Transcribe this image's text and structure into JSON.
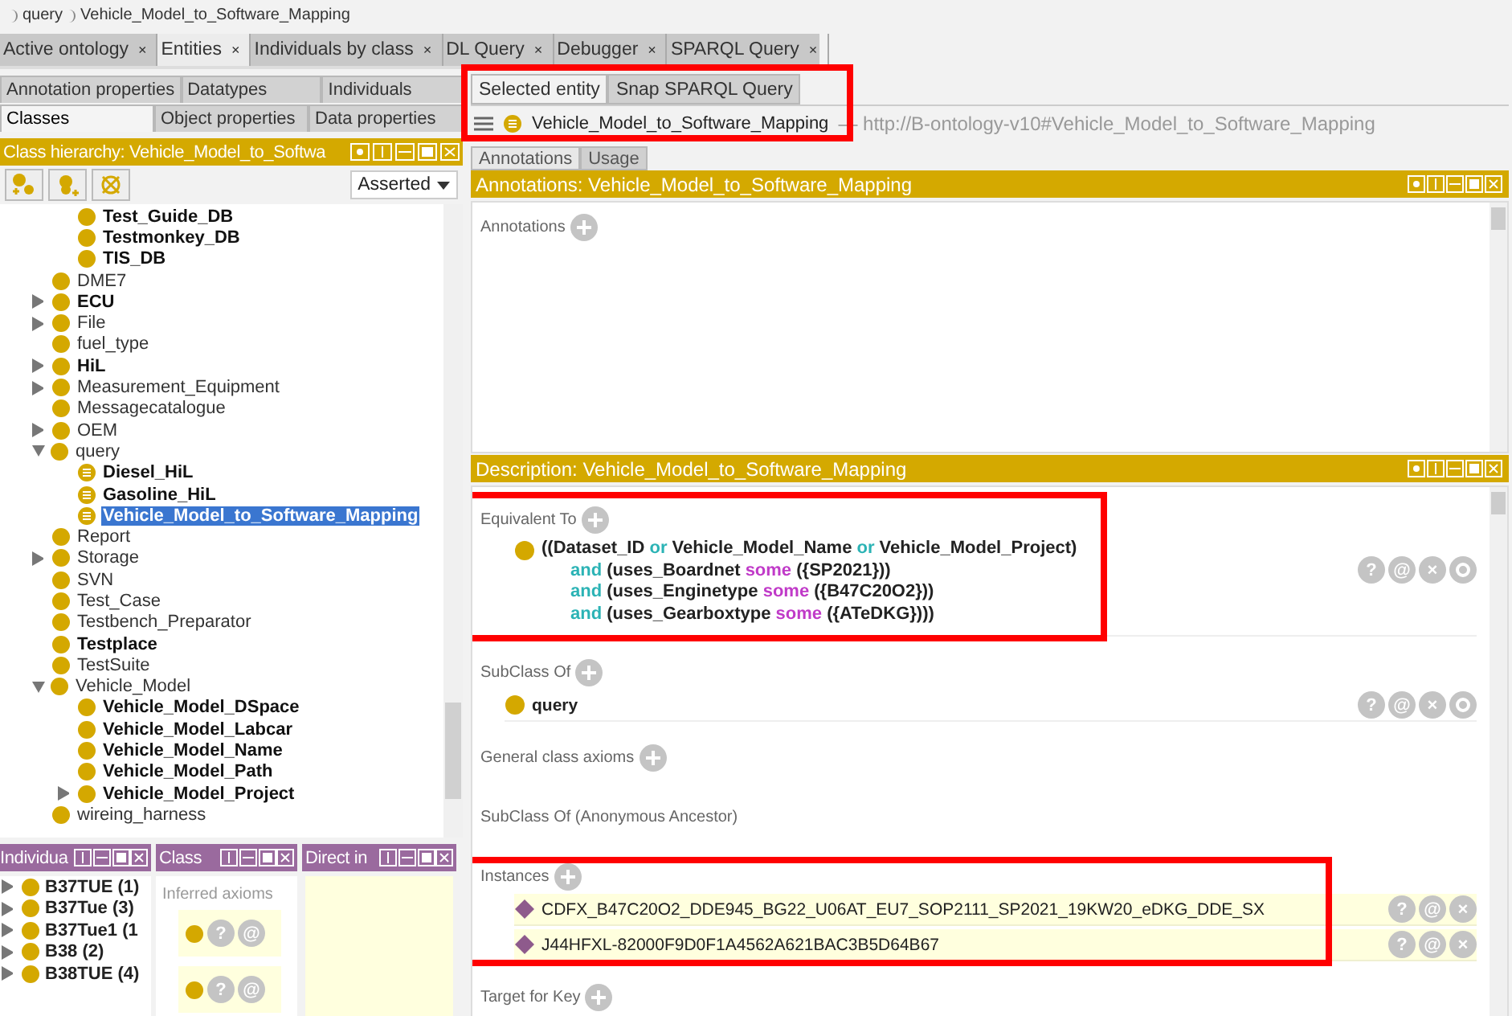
{
  "breadcrumb": [
    "query",
    "Vehicle_Model_to_Software_Mapping"
  ],
  "main_tabs": [
    {
      "label": "Active ontology",
      "close": "×",
      "selected": false
    },
    {
      "label": "Entities",
      "close": "×",
      "selected": true
    },
    {
      "label": "Individuals by class",
      "close": "×",
      "selected": false
    },
    {
      "label": "DL Query",
      "close": "×",
      "selected": false
    },
    {
      "label": "Debugger",
      "close": "×",
      "selected": false
    },
    {
      "label": "SPARQL Query",
      "close": "×",
      "selected": false
    }
  ],
  "left": {
    "tab_rows": [
      [
        {
          "label": "Annotation properties",
          "selected": false
        },
        {
          "label": "Datatypes",
          "selected": false
        },
        {
          "label": "Individuals",
          "selected": false
        }
      ],
      [
        {
          "label": "Classes",
          "selected": true
        },
        {
          "label": "Object properties",
          "selected": false
        },
        {
          "label": "Data properties",
          "selected": false
        }
      ]
    ],
    "hierarchy": {
      "title": "Class hierarchy: Vehicle_Model_to_Softwa",
      "mode": "Asserted",
      "partial_children": [
        {
          "label": "Test_Guide_DB",
          "bold": true,
          "defined": false,
          "selected": false
        },
        {
          "label": "Testmonkey_DB",
          "bold": true,
          "defined": false,
          "selected": false
        },
        {
          "label": "TIS_DB",
          "bold": true,
          "defined": false,
          "selected": false
        }
      ],
      "items": [
        {
          "label": "DME7",
          "bold": false,
          "defined": false,
          "selected": false
        },
        {
          "label": "ECU",
          "bold": true,
          "expanded": false,
          "defined": false,
          "selected": false
        },
        {
          "label": "File",
          "bold": false,
          "expanded": false,
          "defined": false,
          "selected": false
        },
        {
          "label": "fuel_type",
          "bold": false,
          "defined": false,
          "selected": false
        },
        {
          "label": "HiL",
          "bold": true,
          "expanded": false,
          "defined": false,
          "selected": false
        },
        {
          "label": "Measurement_Equipment",
          "bold": false,
          "expanded": false,
          "defined": false,
          "selected": false
        },
        {
          "label": "Messagecatalogue",
          "bold": false,
          "defined": false,
          "selected": false
        },
        {
          "label": "OEM",
          "bold": false,
          "expanded": false,
          "defined": false,
          "selected": false
        },
        {
          "label": "query",
          "bold": false,
          "expanded": true,
          "defined": false,
          "selected": false,
          "children": [
            {
              "label": "Diesel_HiL",
              "bold": true,
              "defined": true,
              "selected": false
            },
            {
              "label": "Gasoline_HiL",
              "bold": true,
              "defined": true,
              "selected": false
            },
            {
              "label": "Vehicle_Model_to_Software_Mapping",
              "bold": true,
              "defined": true,
              "selected": true
            }
          ]
        },
        {
          "label": "Report",
          "bold": false,
          "defined": false,
          "selected": false
        },
        {
          "label": "Storage",
          "bold": false,
          "expanded": false,
          "defined": false,
          "selected": false
        },
        {
          "label": "SVN",
          "bold": false,
          "defined": false,
          "selected": false
        },
        {
          "label": "Test_Case",
          "bold": false,
          "defined": false,
          "selected": false
        },
        {
          "label": "Testbench_Preparator",
          "bold": false,
          "defined": false,
          "selected": false
        },
        {
          "label": "Testplace",
          "bold": true,
          "defined": false,
          "selected": false
        },
        {
          "label": "TestSuite",
          "bold": false,
          "defined": false,
          "selected": false
        },
        {
          "label": "Vehicle_Model",
          "bold": false,
          "expanded": true,
          "defined": false,
          "selected": false,
          "children": [
            {
              "label": "Vehicle_Model_DSpace",
              "bold": true,
              "defined": false,
              "selected": false
            },
            {
              "label": "Vehicle_Model_Labcar",
              "bold": true,
              "defined": false,
              "selected": false
            },
            {
              "label": "Vehicle_Model_Name",
              "bold": true,
              "defined": false,
              "selected": false
            },
            {
              "label": "Vehicle_Model_Path",
              "bold": true,
              "defined": false,
              "selected": false
            },
            {
              "label": "Vehicle_Model_Project",
              "bold": true,
              "expanded": false,
              "defined": false,
              "selected": false
            }
          ]
        },
        {
          "label": "wireing_harness",
          "bold": false,
          "defined": false,
          "selected": false
        }
      ]
    },
    "individuals_panel": {
      "title": "Individua",
      "items": [
        "B37TUE (1)",
        "B37Tue (3)",
        "B37Tue1 (1",
        "B38 (2)",
        "B38TUE (4)"
      ]
    },
    "class_panel": {
      "title": "Class",
      "section": "Inferred axioms",
      "rows": [
        {
          "actions": [
            "?",
            "@"
          ]
        },
        {
          "actions": [
            "?",
            "@"
          ]
        }
      ]
    },
    "direct_panel": {
      "title": "Direct in"
    }
  },
  "right": {
    "tabs": [
      {
        "label": "Selected entity",
        "selected": true
      },
      {
        "label": "Snap SPARQL Query",
        "selected": false
      }
    ],
    "entity": {
      "name": "Vehicle_Model_to_Software_Mapping",
      "iri": "— http://B-ontology-v10#Vehicle_Model_to_Software_Mapping"
    },
    "view_tabs": [
      {
        "label": "Annotations",
        "selected": true
      },
      {
        "label": "Usage",
        "selected": false
      }
    ],
    "annotations": {
      "title": "Annotations: Vehicle_Model_to_Software_Mapping",
      "section": "Annotations"
    },
    "description": {
      "title": "Description: Vehicle_Model_to_Software_Mapping",
      "sections": [
        {
          "label": "Equivalent To",
          "add": true,
          "expression": {
            "actions": [
              "?",
              "@",
              "×"
            ],
            "edit": true,
            "lines": [
              [
                {
                  "text": "((Dataset_ID ",
                  "kind": "name"
                },
                {
                  "text": "or",
                  "kind": "logic"
                },
                {
                  "text": " Vehicle_Model_Name ",
                  "kind": "name"
                },
                {
                  "text": "or",
                  "kind": "logic"
                },
                {
                  "text": " Vehicle_Model_Project)",
                  "kind": "name"
                }
              ],
              [
                {
                  "text": "and",
                  "kind": "logic"
                },
                {
                  "text": " (uses_Boardnet ",
                  "kind": "name"
                },
                {
                  "text": "some",
                  "kind": "quantifier"
                },
                {
                  "text": " ({SP2021}))",
                  "kind": "name"
                }
              ],
              [
                {
                  "text": "and",
                  "kind": "logic"
                },
                {
                  "text": " (uses_Enginetype ",
                  "kind": "name"
                },
                {
                  "text": "some",
                  "kind": "quantifier"
                },
                {
                  "text": " ({B47C20O2}))",
                  "kind": "name"
                }
              ],
              [
                {
                  "text": "and",
                  "kind": "logic"
                },
                {
                  "text": " (uses_Gearboxtype ",
                  "kind": "name"
                },
                {
                  "text": "some",
                  "kind": "quantifier"
                },
                {
                  "text": " ({ATeDKG})))",
                  "kind": "name"
                }
              ]
            ]
          }
        },
        {
          "label": "SubClass Of",
          "add": true,
          "entries": [
            {
              "text": "query",
              "kind": "class",
              "actions": [
                "?",
                "@",
                "×"
              ],
              "edit": true
            }
          ]
        },
        {
          "label": "General class axioms",
          "add": true
        },
        {
          "label": "SubClass Of (Anonymous Ancestor)",
          "add": false
        },
        {
          "label": "Instances",
          "add": true,
          "entries": [
            {
              "text": "CDFX_B47C20O2_DDE945_BG22_U06AT_EU7_SOP2111_SP2021_19KW20_eDKG_DDE_SX",
              "kind": "individual",
              "actions": [
                "?",
                "@",
                "×"
              ],
              "edit": false
            },
            {
              "text": "J44HFXL-82000F9D0F1A4562A621BAC3B5D64B67",
              "kind": "individual",
              "actions": [
                "?",
                "@",
                "×"
              ],
              "edit": false
            }
          ]
        },
        {
          "label": "Target for Key",
          "add": true
        }
      ]
    }
  }
}
